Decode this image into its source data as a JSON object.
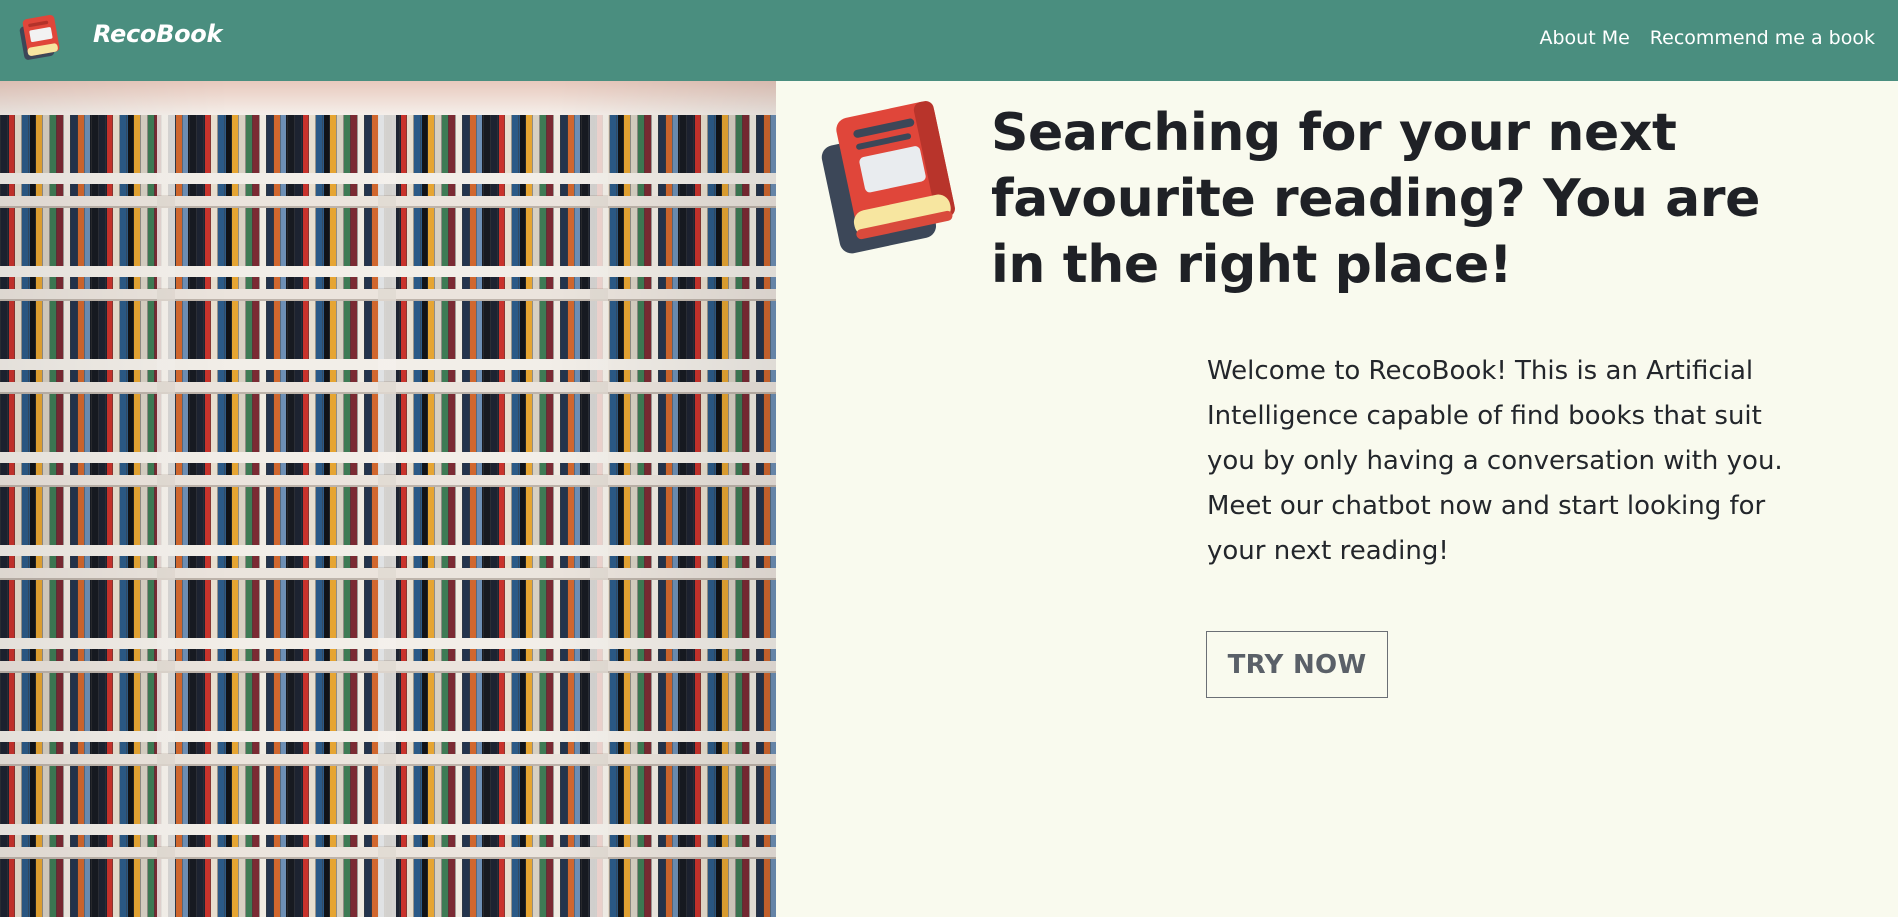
{
  "navbar": {
    "brand": "RecoBook",
    "links": [
      "About Me",
      "Recommend me a book"
    ],
    "background_color": "#4a8e7f",
    "logo_icon": "book-icon"
  },
  "hero": {
    "image_icon": "bookshelf-photo",
    "headline": "Searching for your next favourite reading? You are in the right place!",
    "icon": "book-icon",
    "intro": "Welcome to RecoBook! This is an Artificial Intelligence capable of find books that suit you by only having a conversation with you. Meet our chatbot now and start looking for your next reading!",
    "cta_label": "TRY NOW"
  },
  "colors": {
    "page_background": "#f9faee",
    "book_red": "#e0463a",
    "book_dark": "#3c4758",
    "book_pages": "#f7e6a0"
  }
}
